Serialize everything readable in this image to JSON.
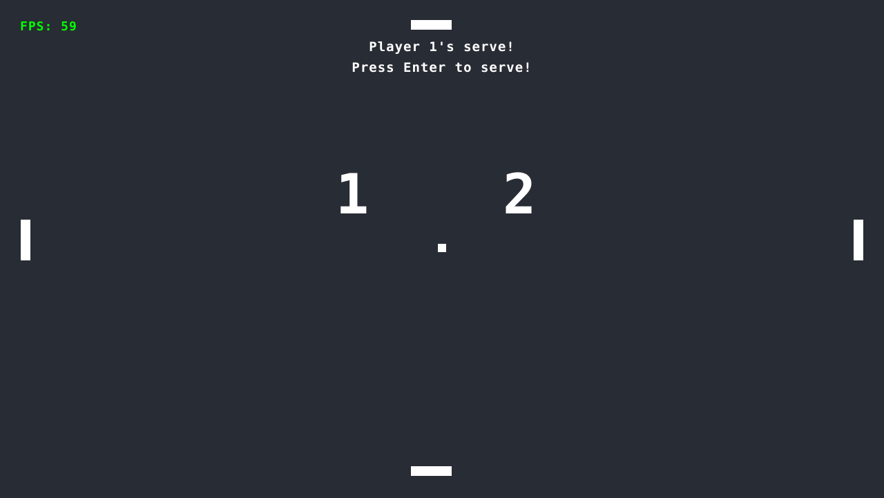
{
  "hud": {
    "fps_text": "FPS: 59"
  },
  "messages": {
    "serve_line": "Player 1's serve!",
    "prompt_line": "Press Enter to serve!"
  },
  "scores": {
    "player1": "1",
    "player2": "2"
  },
  "colors": {
    "background": "#282c34",
    "foreground": "#ffffff",
    "fps": "#00ff00"
  }
}
